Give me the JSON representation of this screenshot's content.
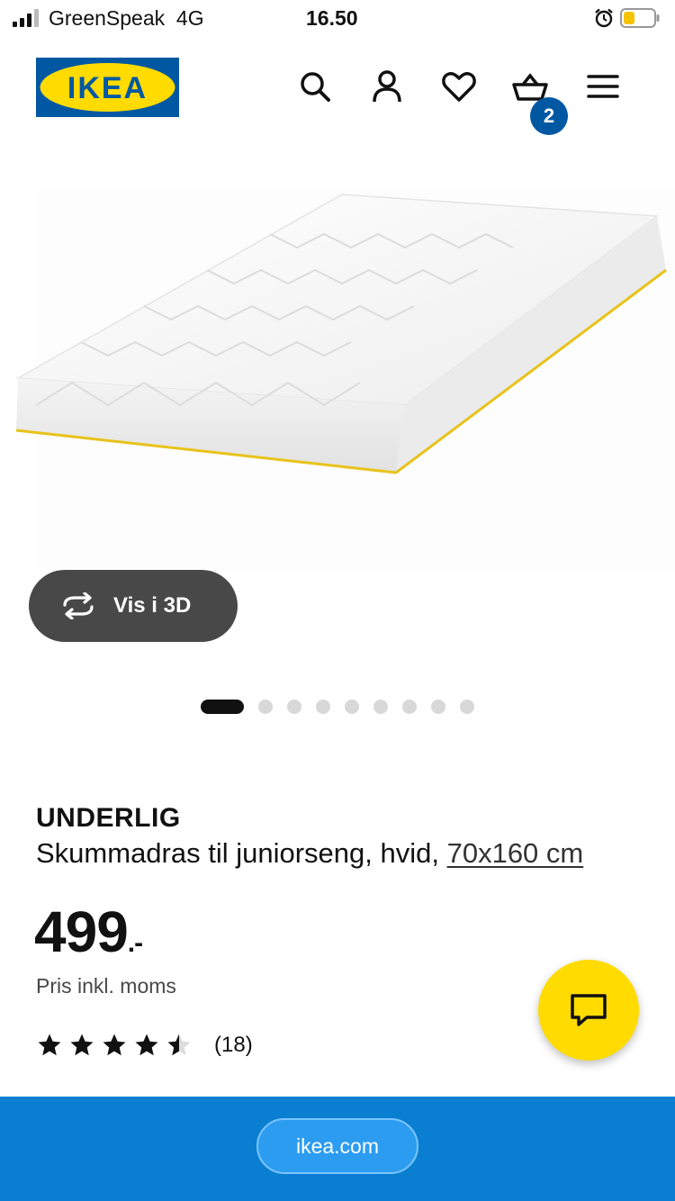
{
  "status_bar": {
    "carrier": "GreenSpeak",
    "network": "4G",
    "time": "16.50",
    "icons": [
      "signal-icon",
      "alarm-icon",
      "battery-icon"
    ]
  },
  "header": {
    "logo_text": "IKEA",
    "icons": [
      "search-icon",
      "profile-icon",
      "heart-icon",
      "cart-icon",
      "menu-icon"
    ],
    "cart_count": "2",
    "brand_colors": {
      "blue": "#0058a3",
      "yellow": "#ffdb00"
    }
  },
  "gallery": {
    "view_3d_label": "Vis i 3D",
    "total_images": 9,
    "active_index": 0
  },
  "product": {
    "name": "UNDERLIG",
    "description_prefix": "Skummadras til juniorseng, hvid, ",
    "size_link": "70x160 cm",
    "price": "499",
    "price_suffix": ".-",
    "price_note": "Pris inkl. moms",
    "rating": 4.5,
    "rating_max": 5,
    "review_count": "(18)"
  },
  "chat": {
    "icon": "chat-icon",
    "color": "#ffdb00"
  },
  "browser": {
    "url": "ikea.com",
    "bar_color": "#0a7fd1"
  }
}
